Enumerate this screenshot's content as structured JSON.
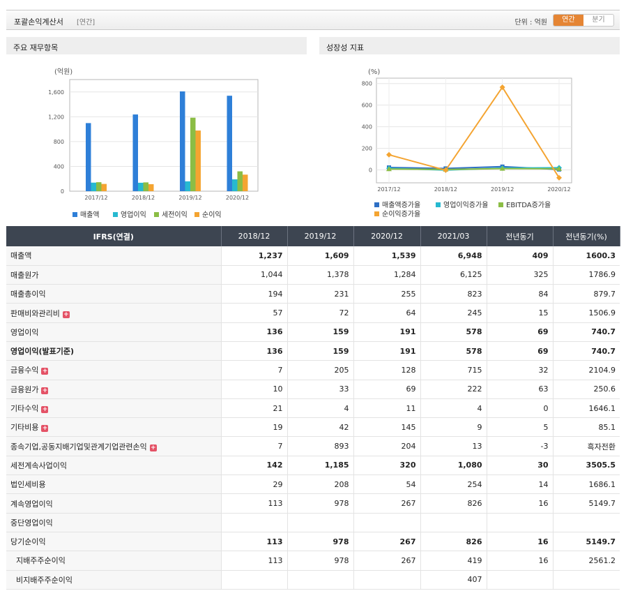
{
  "header": {
    "title": "포괄손익계산서",
    "subtitle": "[연간]",
    "unit": "단위 : 억원",
    "toggle": {
      "annual": "연간",
      "quarter": "분기",
      "selected": "연간"
    }
  },
  "panels": {
    "left_title": "주요 재무항목",
    "right_title": "성장성 지표"
  },
  "chart_data": [
    {
      "type": "bar",
      "ylabel": "(억원)",
      "ylim": [
        0,
        1800
      ],
      "yticks": [
        0,
        400,
        800,
        1200,
        1600
      ],
      "ytick_labels": [
        "0",
        "400",
        "800",
        "1,200",
        "1,600"
      ],
      "categories": [
        "2017/12",
        "2018/12",
        "2019/12",
        "2020/12"
      ],
      "series": [
        {
          "name": "매출액",
          "color": "#2e7fd8",
          "values": [
            1098,
            1237,
            1609,
            1539
          ]
        },
        {
          "name": "영업이익",
          "color": "#27b9d0",
          "values": [
            138,
            136,
            159,
            191
          ]
        },
        {
          "name": "세전이익",
          "color": "#8bbd45",
          "values": [
            145,
            142,
            1185,
            320
          ]
        },
        {
          "name": "순이익",
          "color": "#f4a431",
          "values": [
            117,
            113,
            978,
            267
          ]
        }
      ],
      "legend_position": "bottom-left"
    },
    {
      "type": "line",
      "ylabel": "(%)",
      "ylim": [
        -120,
        850
      ],
      "yticks": [
        0,
        200,
        400,
        600,
        800
      ],
      "ytick_labels": [
        "0",
        "200",
        "400",
        "600",
        "800"
      ],
      "categories": [
        "2017/12",
        "2018/12",
        "2019/12",
        "2020/12"
      ],
      "series": [
        {
          "name": "매출액증가율",
          "color": "#2e6fc4",
          "marker": "square",
          "values": [
            22,
            13,
            30,
            4
          ]
        },
        {
          "name": "영업이익증가율",
          "color": "#27b9d0",
          "marker": "diamond",
          "values": [
            14,
            -2,
            17,
            20
          ]
        },
        {
          "name": "EBITDA증가율",
          "color": "#8bbd45",
          "marker": "triangle",
          "values": [
            8,
            4,
            12,
            10
          ]
        },
        {
          "name": "순이익증가율",
          "color": "#f4a431",
          "marker": "diamond",
          "values": [
            140,
            -3,
            766,
            -73
          ]
        }
      ],
      "legend_position": "bottom-left"
    }
  ],
  "table": {
    "headers": [
      "IFRS(연결)",
      "2018/12",
      "2019/12",
      "2020/12",
      "2021/03",
      "전년동기",
      "전년동기(%)"
    ],
    "rows": [
      {
        "label": "매출액",
        "values": [
          "1,237",
          "1,609",
          "1,539",
          "6,948",
          "409",
          "1600.3"
        ],
        "bold": true
      },
      {
        "label": "매출원가",
        "values": [
          "1,044",
          "1,378",
          "1,284",
          "6,125",
          "325",
          "1786.9"
        ]
      },
      {
        "label": "매출총이익",
        "values": [
          "194",
          "231",
          "255",
          "823",
          "84",
          "879.7"
        ]
      },
      {
        "label": "판매비와관리비",
        "values": [
          "57",
          "72",
          "64",
          "245",
          "15",
          "1506.9"
        ],
        "expand": true
      },
      {
        "label": "영업이익",
        "values": [
          "136",
          "159",
          "191",
          "578",
          "69",
          "740.7"
        ],
        "bold": true
      },
      {
        "label": "영업이익(발표기준)",
        "values": [
          "136",
          "159",
          "191",
          "578",
          "69",
          "740.7"
        ],
        "bold": true,
        "label_bold": true
      },
      {
        "label": "금융수익",
        "values": [
          "7",
          "205",
          "128",
          "715",
          "32",
          "2104.9"
        ],
        "expand": true
      },
      {
        "label": "금융원가",
        "values": [
          "10",
          "33",
          "69",
          "222",
          "63",
          "250.6"
        ],
        "expand": true
      },
      {
        "label": "기타수익",
        "values": [
          "21",
          "4",
          "11",
          "4",
          "0",
          "1646.1"
        ],
        "expand": true
      },
      {
        "label": "기타비용",
        "values": [
          "19",
          "42",
          "145",
          "9",
          "5",
          "85.1"
        ],
        "expand": true
      },
      {
        "label": "종속기업,공동지배기업및관계기업관련손익",
        "values": [
          "7",
          "893",
          "204",
          "13",
          "-3",
          "흑자전환"
        ],
        "expand": true,
        "negative_col": 4
      },
      {
        "label": "세전계속사업이익",
        "values": [
          "142",
          "1,185",
          "320",
          "1,080",
          "30",
          "3505.5"
        ],
        "bold": true
      },
      {
        "label": "법인세비용",
        "values": [
          "29",
          "208",
          "54",
          "254",
          "14",
          "1686.1"
        ]
      },
      {
        "label": "계속영업이익",
        "values": [
          "113",
          "978",
          "267",
          "826",
          "16",
          "5149.7"
        ]
      },
      {
        "label": "중단영업이익",
        "values": [
          "",
          "",
          "",
          "",
          "",
          ""
        ]
      },
      {
        "label": "당기순이익",
        "values": [
          "113",
          "978",
          "267",
          "826",
          "16",
          "5149.7"
        ],
        "bold": true
      },
      {
        "label": "지배주주순이익",
        "values": [
          "113",
          "978",
          "267",
          "419",
          "16",
          "2561.2"
        ],
        "indent": true
      },
      {
        "label": "비지배주주순이익",
        "values": [
          "",
          "",
          "",
          "407",
          "",
          ""
        ],
        "indent": true
      }
    ]
  }
}
